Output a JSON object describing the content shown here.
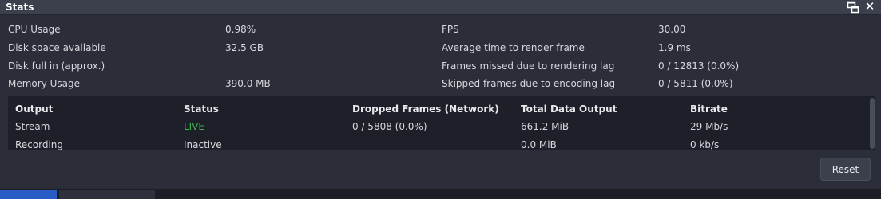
{
  "window": {
    "title": "Stats"
  },
  "icons": {
    "float": "float-window-icon",
    "close": "close-icon",
    "close_glyph": "✕"
  },
  "stats": {
    "cpu_usage_label": "CPU Usage",
    "cpu_usage_value": "0.98%",
    "disk_space_label": "Disk space available",
    "disk_space_value": "32.5 GB",
    "disk_full_label": "Disk full in (approx.)",
    "disk_full_value": "",
    "memory_usage_label": "Memory Usage",
    "memory_usage_value": "390.0 MB",
    "fps_label": "FPS",
    "fps_value": "30.00",
    "avg_render_label": "Average time to render frame",
    "avg_render_value": "1.9 ms",
    "frames_missed_label": "Frames missed due to rendering lag",
    "frames_missed_value": "0 / 12813 (0.0%)",
    "skipped_frames_label": "Skipped frames due to encoding lag",
    "skipped_frames_value": "0 / 5811 (0.0%)"
  },
  "outputs_table": {
    "headers": [
      "Output",
      "Status",
      "Dropped Frames (Network)",
      "Total Data Output",
      "Bitrate"
    ],
    "rows": [
      [
        "Stream",
        "LIVE",
        "0 / 5808 (0.0%)",
        "661.2 MiB",
        "29 Mb/s"
      ],
      [
        "Recording",
        "Inactive",
        "",
        "0.0 MiB",
        "0 kb/s"
      ]
    ]
  },
  "buttons": {
    "reset_label": "Reset"
  },
  "colors": {
    "live_status": "#3fb14d",
    "background": "#2b2e38",
    "titlebar": "#3c404d",
    "table_background": "#1e2029",
    "accent_tab": "#2a5cc6"
  }
}
